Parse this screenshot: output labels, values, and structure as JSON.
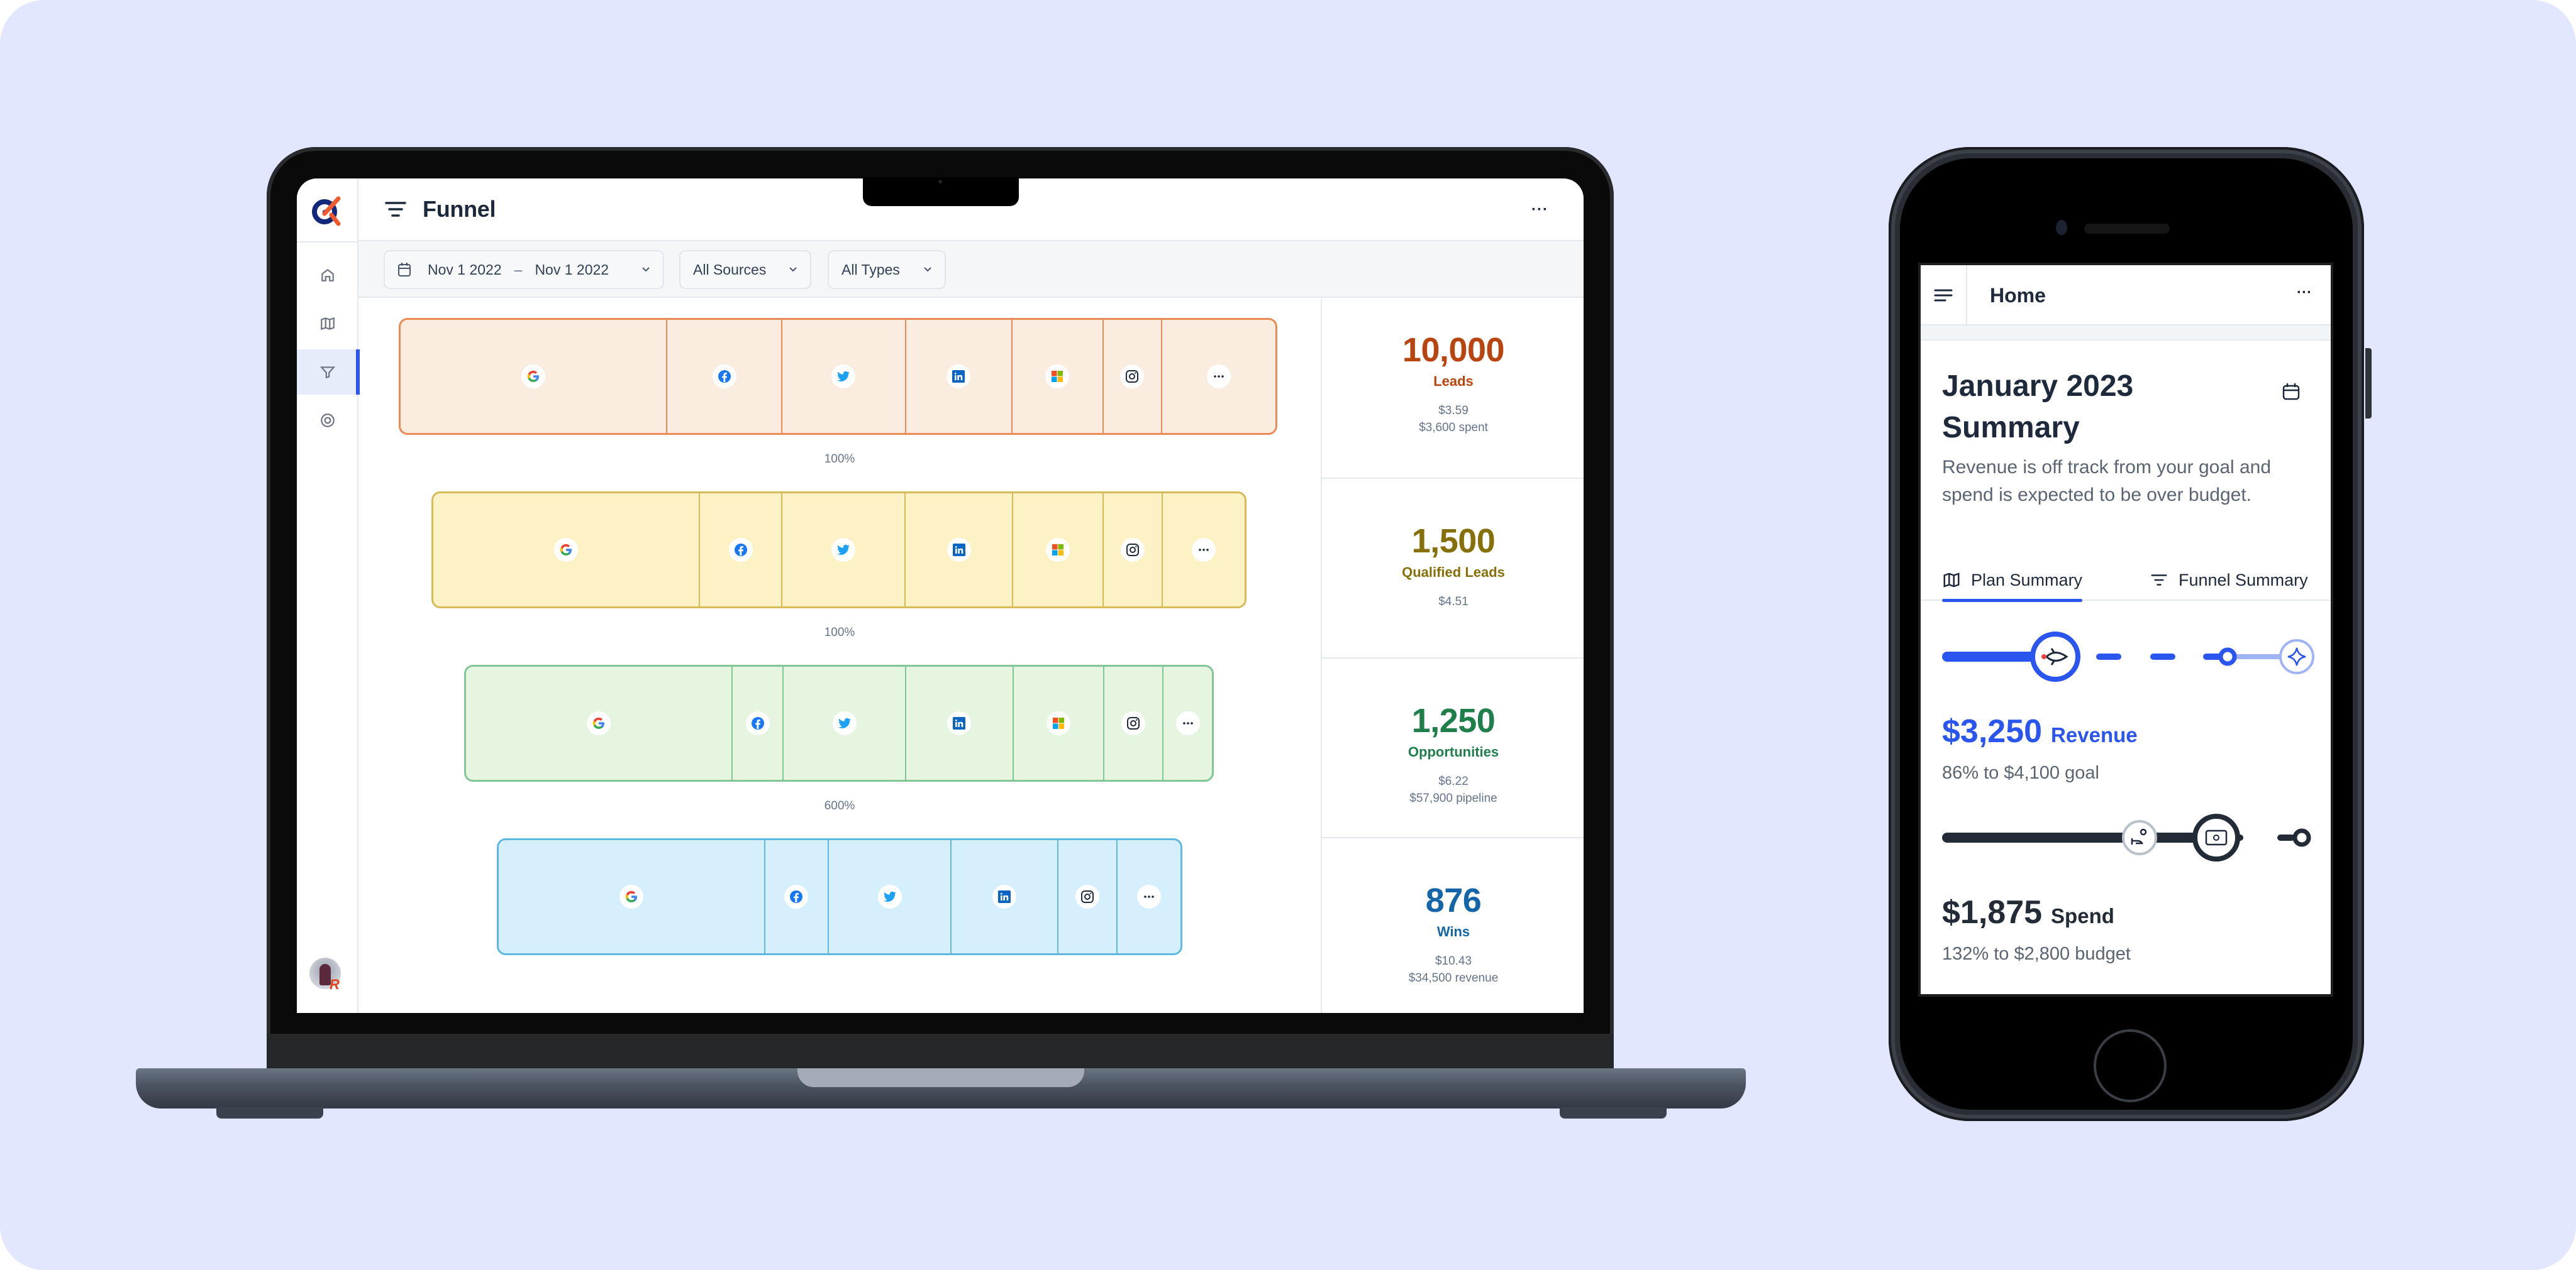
{
  "desktop": {
    "app_title": "Funnel",
    "header_more": "···",
    "nav": [
      {
        "name": "home",
        "icon": "home-icon",
        "active": false
      },
      {
        "name": "plan",
        "icon": "map-icon",
        "active": false
      },
      {
        "name": "funnel",
        "icon": "funnel-icon",
        "active": true
      },
      {
        "name": "channels",
        "icon": "target-icon",
        "active": false
      }
    ],
    "filters": {
      "date_start": "Nov 1 2022",
      "date_sep": "–",
      "date_end": "Nov 1 2022",
      "sources": "All Sources",
      "types": "All Types"
    },
    "stages": [
      {
        "name": "Leads",
        "value": "10,000",
        "line1": "$3.59",
        "line2": "$3,600 spent",
        "color": "#b8440f",
        "fill": "#fbece0",
        "border": "#ea8a57",
        "sources": [
          "google",
          "facebook",
          "twitter",
          "linkedin",
          "microsoft",
          "instagram",
          "more"
        ],
        "shares": [
          426,
          184,
          197,
          170,
          146,
          93,
          181
        ]
      },
      {
        "name": "Qualified Leads",
        "value": "1,500",
        "line1": "$4.51",
        "line2": "",
        "color": "#86700a",
        "fill": "#fdf2c6",
        "border": "#d6bb57",
        "sources": [
          "google",
          "facebook",
          "twitter",
          "linkedin",
          "microsoft",
          "instagram",
          "more"
        ],
        "shares": [
          426,
          132,
          197,
          171,
          145,
          94,
          131
        ]
      },
      {
        "name": "Opportunities",
        "value": "1,250",
        "line1": "$6.22",
        "line2": "$57,900 pipeline",
        "color": "#1f7f4a",
        "fill": "#e5f5df",
        "border": "#82c596",
        "sources": [
          "google",
          "facebook",
          "twitter",
          "linkedin",
          "microsoft",
          "instagram",
          "more"
        ],
        "shares": [
          426,
          82,
          196,
          171,
          145,
          95,
          77
        ]
      },
      {
        "name": "Wins",
        "value": "876",
        "line1": "$10.43",
        "line2": "$34,500 revenue",
        "color": "#1466a8",
        "fill": "#d5f0fc",
        "border": "#5eb8e2",
        "sources": [
          "google",
          "facebook",
          "twitter",
          "linkedin",
          "instagram",
          "more"
        ],
        "shares": [
          426,
          102,
          196,
          171,
          94,
          101
        ]
      }
    ],
    "conversions": [
      "100%",
      "100%",
      "600%"
    ]
  },
  "mobile": {
    "title": "Home",
    "more": "···",
    "heading": "January 2023 Summary",
    "description": "Revenue is off track from your goal and spend is expected to be over budget.",
    "tabs": [
      {
        "label": "Plan Summary",
        "icon": "map-icon",
        "active": true
      },
      {
        "label": "Funnel Summary",
        "icon": "funnel-icon",
        "active": false
      }
    ],
    "revenue": {
      "amount": "$3,250",
      "label": "Revenue",
      "detail": "86% to $4,100 goal",
      "progress_pct": 86,
      "color": "#2b55ef"
    },
    "spend": {
      "amount": "$1,875",
      "label": "Spend",
      "detail": "132% to $2,800 budget",
      "progress_pct": 132,
      "color": "#232b36"
    }
  }
}
